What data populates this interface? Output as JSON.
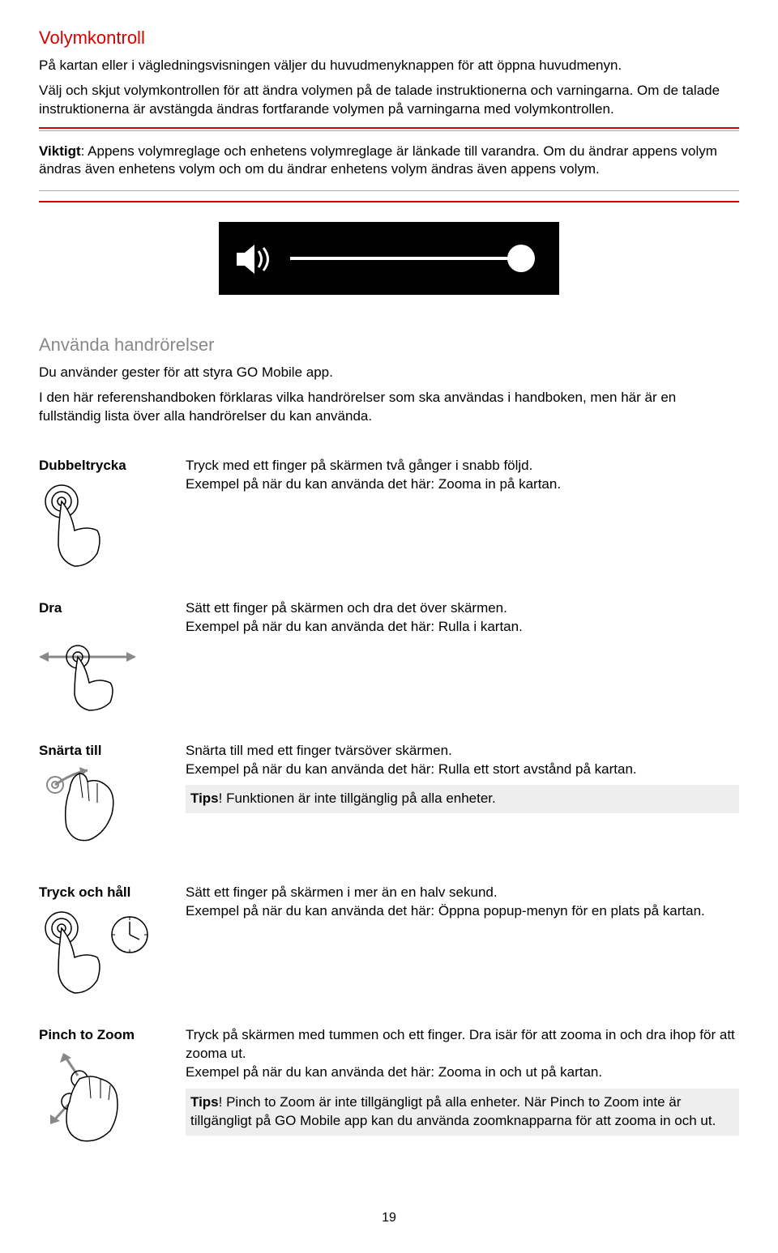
{
  "vol": {
    "heading": "Volymkontroll",
    "p1": "På kartan eller i vägledningsvisningen väljer du huvudmenyknappen för att öppna huvudmenyn.",
    "p2": "Välj och skjut volymkontrollen för att ändra volymen på de talade instruktionerna och varningarna. Om de talade instruktionerna är avstängda ändras fortfarande volymen på varningarna med volymkontrollen.",
    "imp_label": "Viktigt",
    "imp_text": ": Appens volymreglage och enhetens volymreglage är länkade till varandra. Om du ändrar appens volym ändras även enhetens volym och om du ändrar enhetens volym ändras även appens volym."
  },
  "gest": {
    "heading": "Använda handrörelser",
    "intro1": "Du använder gester för att styra GO Mobile app.",
    "intro2": "I den här referenshandboken förklaras vilka handrörelser som ska användas i handboken, men här är en fullständig lista över alla handrörelser du kan använda."
  },
  "rows": [
    {
      "name": "Dubbeltrycka",
      "line1": "Tryck med ett finger på skärmen två gånger i snabb följd.",
      "line2": "Exempel på när du kan använda det här: Zooma in på kartan."
    },
    {
      "name": "Dra",
      "line1": "Sätt ett finger på skärmen och dra det över skärmen.",
      "line2": "Exempel på när du kan använda det här: Rulla i kartan."
    },
    {
      "name": "Snärta till",
      "line1": "Snärta till med ett finger tvärsöver skärmen.",
      "line2": "Exempel på när du kan använda det här: Rulla ett stort avstånd på kartan.",
      "tip_label": "Tips",
      "tip_text": "! Funktionen är inte tillgänglig på alla enheter."
    },
    {
      "name": "Tryck och håll",
      "line1": "Sätt ett finger på skärmen i mer än en halv sekund.",
      "line2": "Exempel på när du kan använda det här: Öppna popup-menyn för en plats på kartan."
    },
    {
      "name": "Pinch to Zoom",
      "line1": "Tryck på skärmen med tummen och ett finger. Dra isär för att zooma in och dra ihop för att zooma ut.",
      "line2": "Exempel på när du kan använda det här: Zooma in och ut på kartan.",
      "tip_label": "Tips",
      "tip_text": "! Pinch to Zoom är inte tillgängligt på alla enheter. När Pinch to Zoom inte är tillgängligt på GO Mobile app kan du använda zoomknapparna för att zooma in och ut."
    }
  ],
  "page": "19"
}
